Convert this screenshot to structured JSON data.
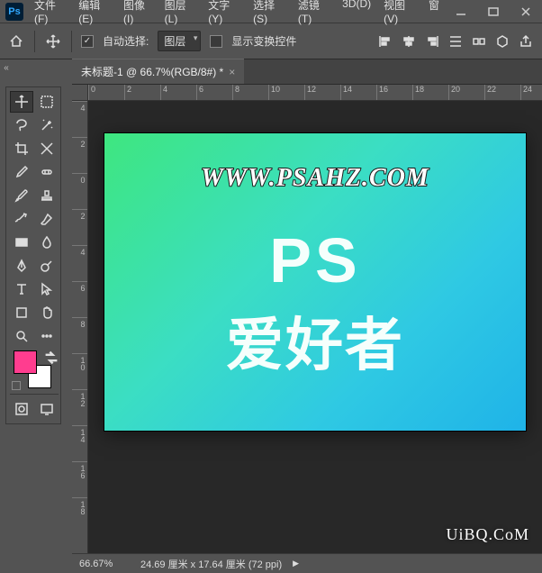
{
  "app": {
    "logo": "Ps"
  },
  "menu": [
    "文件(F)",
    "编辑(E)",
    "图像(I)",
    "图层(L)",
    "文字(Y)",
    "选择(S)",
    "滤镜(T)",
    "3D(D)",
    "视图(V)",
    "窗"
  ],
  "options": {
    "auto_select_label": "自动选择:",
    "auto_select_value": "图层",
    "show_transform_label": "显示变换控件"
  },
  "tab": {
    "title": "未标题-1 @ 66.7%(RGB/8#) *"
  },
  "ruler_h": [
    "0",
    "2",
    "4",
    "6",
    "8",
    "10",
    "12",
    "14",
    "16",
    "18",
    "20",
    "22",
    "24"
  ],
  "ruler_v": [
    "4",
    "2",
    "0",
    "2",
    "4",
    "6",
    "8",
    "10",
    "12",
    "14",
    "16",
    "18"
  ],
  "canvas": {
    "url": "WWW.PSAHZ.COM",
    "line1": "PS",
    "line2": "爱好者"
  },
  "colors": {
    "foreground": "#ff3d8f",
    "background": "#ffffff"
  },
  "status": {
    "zoom": "66.67%",
    "dims": "24.69 厘米 x 17.64 厘米 (72 ppi)"
  },
  "watermark": "UiBQ.CoM"
}
